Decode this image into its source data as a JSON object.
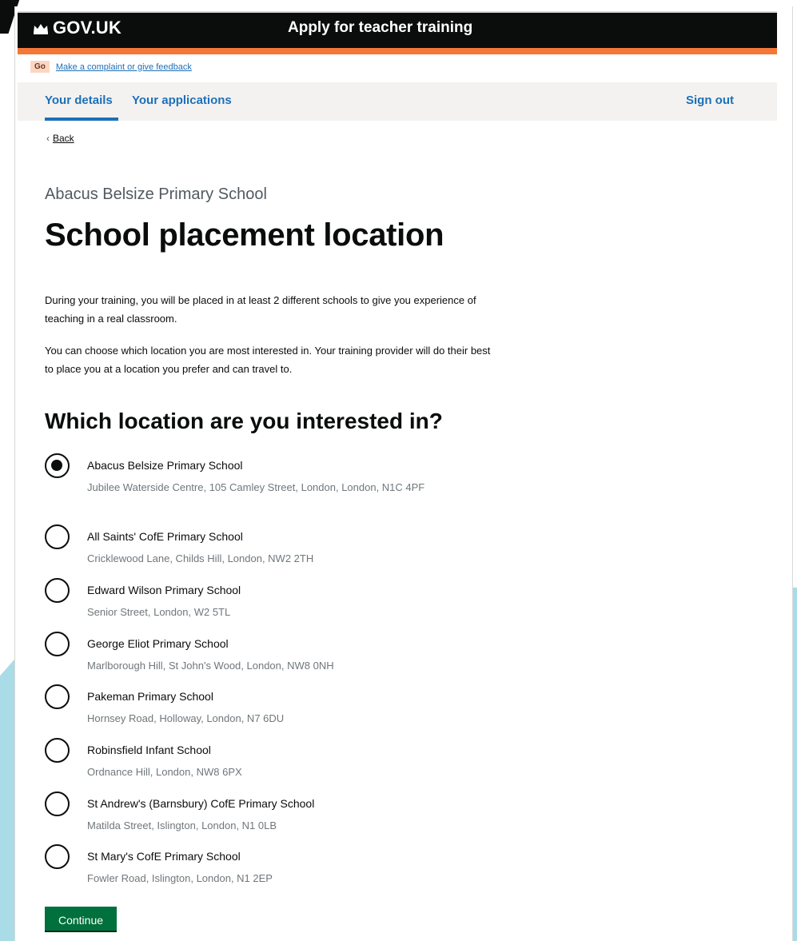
{
  "header": {
    "logo_text": "GOV.UK",
    "service_name": "Apply for teacher training"
  },
  "phase_banner": {
    "tag": "Go",
    "link": "Make a complaint or give feedback"
  },
  "nav": {
    "items": [
      {
        "label": "Your details",
        "current": true
      },
      {
        "label": "Your applications",
        "current": false
      }
    ],
    "sign_out": "Sign out"
  },
  "back_link": {
    "label": "Back"
  },
  "page": {
    "caption": "Abacus Belsize Primary School",
    "title": "School placement location",
    "paragraphs": [
      "During your training, you will be placed in at least 2 different schools to give you experience of teaching in a real classroom.",
      "You can choose which location you are most interested in. Your training provider will do their best to place you at a location you prefer and can travel to."
    ],
    "question": "Which location are you interested in?"
  },
  "locations": [
    {
      "name": "Abacus Belsize Primary School",
      "address": "Jubilee Waterside Centre, 105 Camley Street, London, London, N1C 4PF",
      "selected": true
    },
    {
      "name": "All Saints' CofE Primary School",
      "address": "Cricklewood Lane, Childs Hill, London, NW2 2TH",
      "selected": false
    },
    {
      "name": "Edward Wilson Primary School",
      "address": "Senior Street, London, W2 5TL",
      "selected": false
    },
    {
      "name": "George Eliot Primary School",
      "address": "Marlborough Hill, St John's Wood, London, NW8 0NH",
      "selected": false
    },
    {
      "name": "Pakeman Primary School",
      "address": "Hornsey Road, Holloway, London, N7 6DU",
      "selected": false
    },
    {
      "name": "Robinsfield Infant School",
      "address": "Ordnance Hill, London, NW8 6PX",
      "selected": false
    },
    {
      "name": "St Andrew's (Barnsbury) CofE Primary School",
      "address": "Matilda Street, Islington, London, N1 0LB",
      "selected": false
    },
    {
      "name": "St Mary's CofE Primary School",
      "address": "Fowler Road, Islington, London, N1 2EP",
      "selected": false
    }
  ],
  "actions": {
    "continue_label": "Continue"
  },
  "colors": {
    "header_bg": "#0b0c0c",
    "header_border": "#f47738",
    "link": "#1d70b8",
    "button": "#00703c",
    "hint": "#6f777b"
  }
}
